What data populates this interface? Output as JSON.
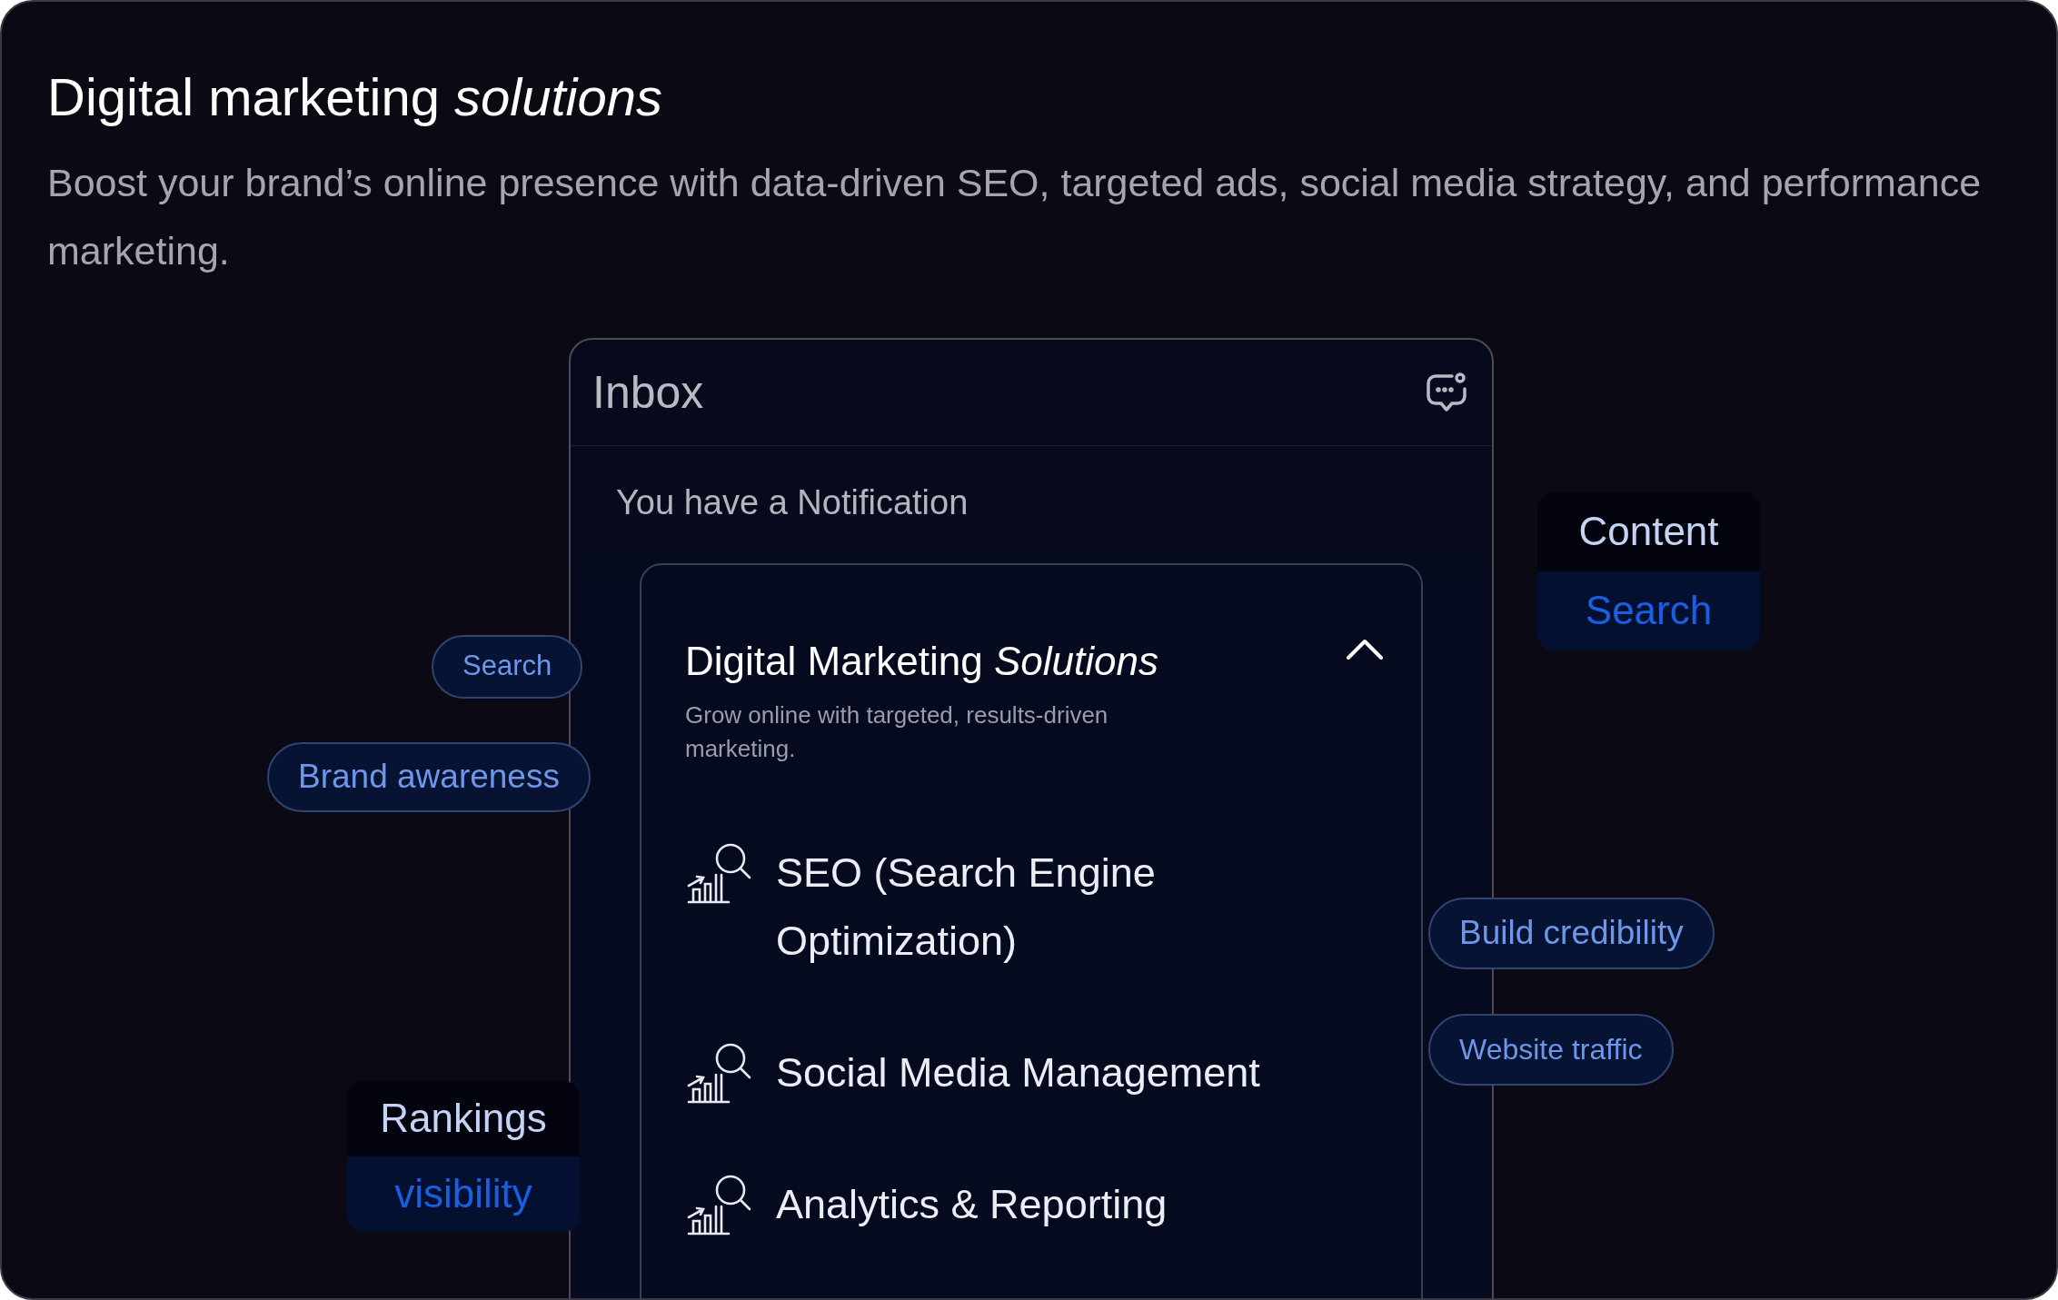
{
  "heading": "Digital marketing *solutions*",
  "description": "Boost your brand’s online presence with data-driven SEO, targeted ads, social media strategy, and performance marketing.",
  "inbox": {
    "title": "Inbox",
    "notification": "You have a Notification",
    "card": {
      "title": "Digital Marketing *Solutions*",
      "subtitle": "Grow online with targeted, results-driven marketing.",
      "expanded": true,
      "items": [
        {
          "label": "SEO (Search Engine Optimization)"
        },
        {
          "label": "Social Media Management"
        },
        {
          "label": "Analytics & Reporting"
        }
      ]
    }
  },
  "chips": [
    {
      "kind": "pill",
      "text": "Search"
    },
    {
      "kind": "pill",
      "text": "Brand awareness"
    },
    {
      "kind": "stack",
      "top": "Content",
      "bottom": "Search"
    },
    {
      "kind": "pill",
      "text": "Build credibility"
    },
    {
      "kind": "pill",
      "text": "Website traffic"
    },
    {
      "kind": "stack",
      "top": "Rankings",
      "bottom": "visibility"
    }
  ]
}
